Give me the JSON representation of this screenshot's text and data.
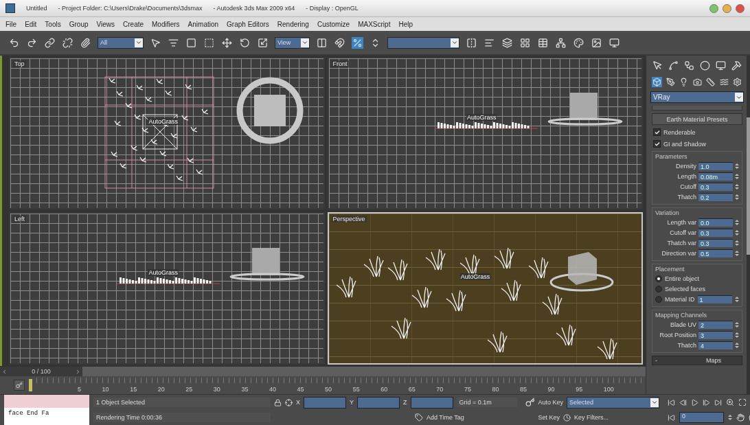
{
  "window": {
    "title_parts": [
      "Untitled",
      "- Project Folder: C:\\Users\\Drake\\Documents\\3dsmax",
      "- Autodesk 3ds Max  2009 x64",
      "- Display : OpenGL"
    ]
  },
  "menu": [
    "File",
    "Edit",
    "Tools",
    "Group",
    "Views",
    "Create",
    "Modifiers",
    "Animation",
    "Graph Editors",
    "Rendering",
    "Customize",
    "MAXScript",
    "Help"
  ],
  "toolbar": {
    "selection_filter": "All",
    "reference_coord": "View"
  },
  "viewports": [
    {
      "label": "Top",
      "kind": "top",
      "active": false,
      "object_label": "AutoGrass"
    },
    {
      "label": "Front",
      "kind": "side",
      "active": false,
      "object_label": "AutoGrass"
    },
    {
      "label": "Left",
      "kind": "side",
      "active": false,
      "object_label": "AutoGrass"
    },
    {
      "label": "Perspective",
      "kind": "perspective",
      "active": true,
      "object_label": "AutoGrass"
    }
  ],
  "command_panel": {
    "tabs": [
      {
        "selected": false
      },
      {
        "selected": false
      },
      {
        "selected": false
      },
      {
        "selected": false
      },
      {
        "selected": false
      },
      {
        "selected": false
      }
    ],
    "categories": [
      {
        "selected": true
      },
      {
        "selected": false
      },
      {
        "selected": false
      },
      {
        "selected": false
      },
      {
        "selected": false
      },
      {
        "selected": false
      },
      {
        "selected": false
      }
    ],
    "renderer": "VRay",
    "presets_button": "Earth Material Presets",
    "checkboxes": [
      {
        "label": "Renderable",
        "checked": true
      },
      {
        "label": "GI and Shadow",
        "checked": true
      }
    ],
    "groups": [
      {
        "title": "Parameters",
        "kind": "spinners",
        "rows": [
          {
            "label": "Density",
            "value": "1.0"
          },
          {
            "label": "Length",
            "value": "0.08m"
          },
          {
            "label": "Cutoff",
            "value": "0.3"
          },
          {
            "label": "Thatch",
            "value": "0.2"
          }
        ]
      },
      {
        "title": "Variation",
        "kind": "spinners",
        "rows": [
          {
            "label": "Length var",
            "value": "0.0"
          },
          {
            "label": "Cutoff var",
            "value": "0.3"
          },
          {
            "label": "Thatch var",
            "value": "0.3"
          },
          {
            "label": "Direction var",
            "value": "0.5"
          }
        ]
      },
      {
        "title": "Placement",
        "kind": "radios",
        "rows": [
          {
            "label": "Entire object",
            "selected": true
          },
          {
            "label": "Selected faces",
            "selected": false
          },
          {
            "label": "Material ID",
            "selected": false,
            "value": "1"
          }
        ]
      },
      {
        "title": "Mapping Channels",
        "kind": "spinners",
        "rows": [
          {
            "label": "Blade UV",
            "value": "2"
          },
          {
            "label": "Root Position",
            "value": "3"
          },
          {
            "label": "Thatch",
            "value": "4"
          }
        ]
      }
    ],
    "rollout": {
      "sign": "-",
      "title": "Maps"
    }
  },
  "time_slider": {
    "position": "0 / 100",
    "level": 0
  },
  "track_bar": {
    "ticks": [
      "5",
      "10",
      "15",
      "20",
      "25",
      "30",
      "35",
      "40",
      "45",
      "50",
      "55",
      "60",
      "65",
      "70",
      "75",
      "80",
      "85",
      "90",
      "95",
      "100"
    ]
  },
  "status": {
    "listener_output": "face End Fa",
    "selection": "1 Object Selected",
    "prompt": "Rendering Time  0:00:36",
    "coords": [
      "X",
      "Y",
      "Z"
    ],
    "grid": "Grid = 0.1m",
    "time_tag": "Add Time Tag",
    "auto_key": "Auto Key",
    "key_mode": "Selected",
    "set_key": "Set Key",
    "key_filters": "Key Filters...",
    "frame": "0"
  }
}
